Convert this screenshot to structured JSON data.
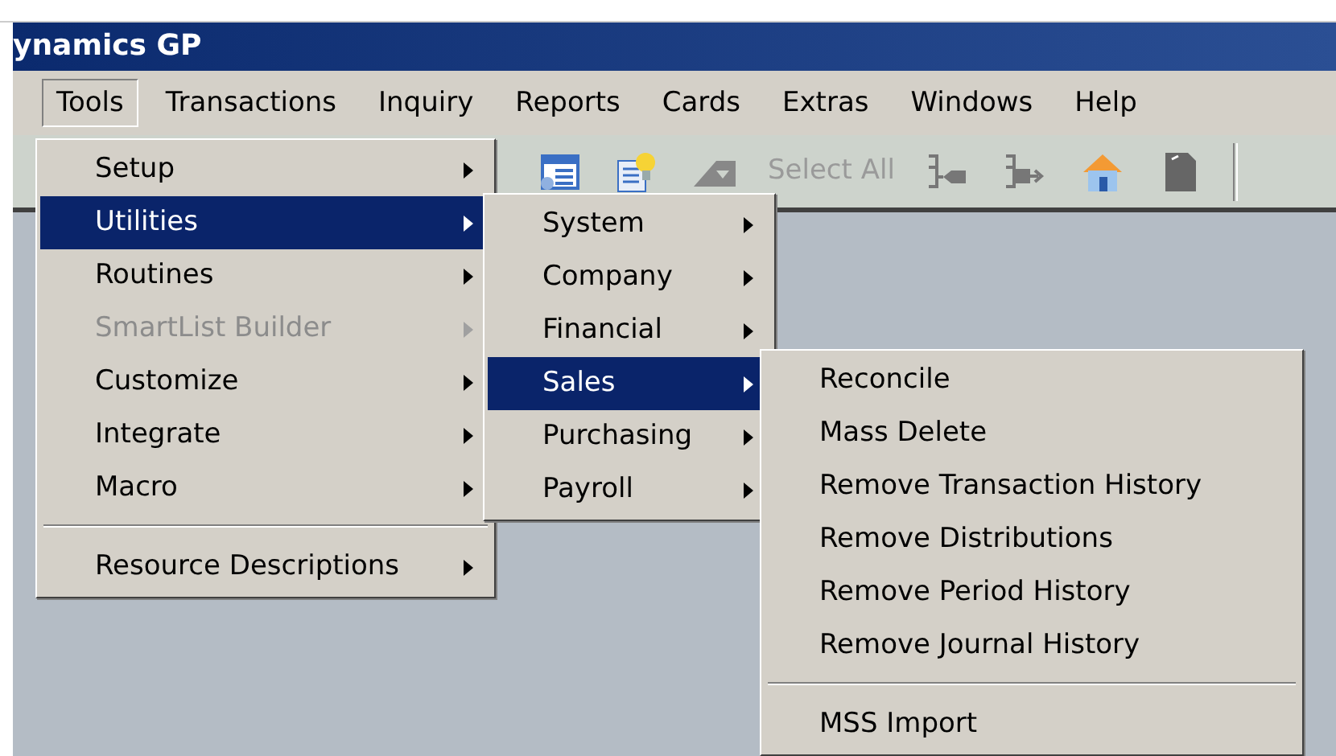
{
  "window": {
    "title": "ynamics GP"
  },
  "menu_bar": [
    {
      "label": "Tools",
      "selected": true
    },
    {
      "label": "Transactions",
      "selected": false
    },
    {
      "label": "Inquiry",
      "selected": false
    },
    {
      "label": "Reports",
      "selected": false
    },
    {
      "label": "Cards",
      "selected": false
    },
    {
      "label": "Extras",
      "selected": false
    },
    {
      "label": "Windows",
      "selected": false
    },
    {
      "label": "Help",
      "selected": false
    }
  ],
  "toolbar": {
    "select_all": {
      "label": "Select All",
      "disabled": true
    }
  },
  "menus": [
    {
      "items": [
        {
          "kind": "item",
          "label": "Setup",
          "selected": false,
          "disabled": false,
          "submenu": true
        },
        {
          "kind": "item",
          "label": "Utilities",
          "selected": true,
          "disabled": false,
          "submenu": true
        },
        {
          "kind": "item",
          "label": "Routines",
          "selected": false,
          "disabled": false,
          "submenu": true
        },
        {
          "kind": "item",
          "label": "SmartList Builder",
          "selected": false,
          "disabled": true,
          "submenu": true
        },
        {
          "kind": "item",
          "label": "Customize",
          "selected": false,
          "disabled": false,
          "submenu": true
        },
        {
          "kind": "item",
          "label": "Integrate",
          "selected": false,
          "disabled": false,
          "submenu": true
        },
        {
          "kind": "item",
          "label": "Macro",
          "selected": false,
          "disabled": false,
          "submenu": true
        },
        {
          "kind": "separator"
        },
        {
          "kind": "item",
          "label": "Resource Descriptions",
          "selected": false,
          "disabled": false,
          "submenu": true
        }
      ]
    },
    {
      "items": [
        {
          "kind": "item",
          "label": "System",
          "selected": false,
          "disabled": false,
          "submenu": true
        },
        {
          "kind": "item",
          "label": "Company",
          "selected": false,
          "disabled": false,
          "submenu": true
        },
        {
          "kind": "item",
          "label": "Financial",
          "selected": false,
          "disabled": false,
          "submenu": true
        },
        {
          "kind": "item",
          "label": "Sales",
          "selected": true,
          "disabled": false,
          "submenu": true
        },
        {
          "kind": "item",
          "label": "Purchasing",
          "selected": false,
          "disabled": false,
          "submenu": true
        },
        {
          "kind": "item",
          "label": "Payroll",
          "selected": false,
          "disabled": false,
          "submenu": true
        }
      ]
    },
    {
      "items": [
        {
          "kind": "item",
          "label": "Reconcile",
          "selected": false,
          "disabled": false,
          "submenu": false
        },
        {
          "kind": "item",
          "label": "Mass Delete",
          "selected": false,
          "disabled": false,
          "submenu": false
        },
        {
          "kind": "item",
          "label": "Remove Transaction History",
          "selected": false,
          "disabled": false,
          "submenu": false
        },
        {
          "kind": "item",
          "label": "Remove Distributions",
          "selected": false,
          "disabled": false,
          "submenu": false
        },
        {
          "kind": "item",
          "label": "Remove Period History",
          "selected": false,
          "disabled": false,
          "submenu": false
        },
        {
          "kind": "item",
          "label": "Remove Journal History",
          "selected": false,
          "disabled": false,
          "submenu": false
        },
        {
          "kind": "separator"
        },
        {
          "kind": "item",
          "label": "MSS Import",
          "selected": false,
          "disabled": false,
          "submenu": false
        }
      ]
    }
  ]
}
